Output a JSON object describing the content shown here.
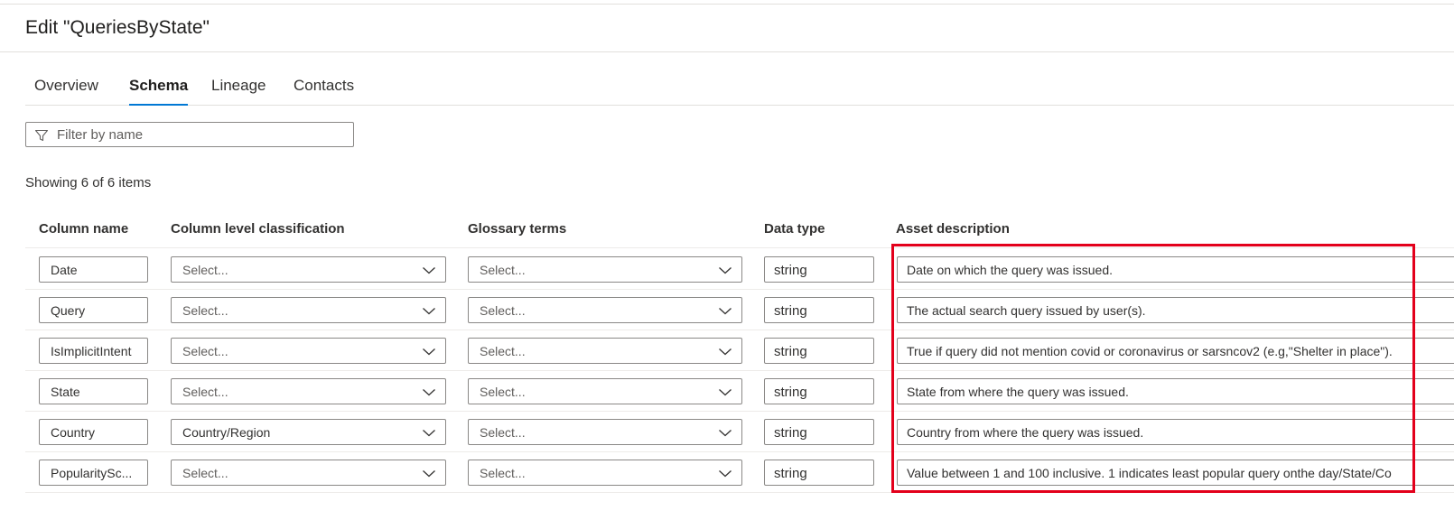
{
  "header": {
    "title": "Edit \"QueriesByState\""
  },
  "tabs": [
    {
      "label": "Overview",
      "active": false
    },
    {
      "label": "Schema",
      "active": true
    },
    {
      "label": "Lineage",
      "active": false
    },
    {
      "label": "Contacts",
      "active": false
    }
  ],
  "filter": {
    "placeholder": "Filter by name",
    "value": "",
    "icon": "filter-icon"
  },
  "item_count": "Showing 6 of 6 items",
  "columns": {
    "name": "Column name",
    "classification": "Column level classification",
    "glossary": "Glossary terms",
    "data_type": "Data type",
    "description": "Asset description"
  },
  "rows": [
    {
      "name": "Date",
      "classification": "Select...",
      "glossary": "Select...",
      "data_type": "string",
      "description": "Date on which the query was issued."
    },
    {
      "name": "Query",
      "classification": "Select...",
      "glossary": "Select...",
      "data_type": "string",
      "description": "The actual search query issued by user(s)."
    },
    {
      "name": "IsImplicitIntent",
      "classification": "Select...",
      "glossary": "Select...",
      "data_type": "string",
      "description": "True if query did not mention covid or coronavirus or sarsncov2 (e.g,\"Shelter in place\")."
    },
    {
      "name": "State",
      "classification": "Select...",
      "glossary": "Select...",
      "data_type": "string",
      "description": "State from where the query was issued."
    },
    {
      "name": "Country",
      "classification": "Country/Region",
      "glossary": "Select...",
      "data_type": "string",
      "description": "Country from where the query was issued."
    },
    {
      "name": "PopularitySc...",
      "classification": "Select...",
      "glossary": "Select...",
      "data_type": "string",
      "description": "Value between 1 and 100 inclusive. 1 indicates least popular query onthe day/State/Co"
    }
  ],
  "colors": {
    "accent": "#0078d4",
    "highlight": "#e3001b",
    "border": "#8a8886"
  }
}
